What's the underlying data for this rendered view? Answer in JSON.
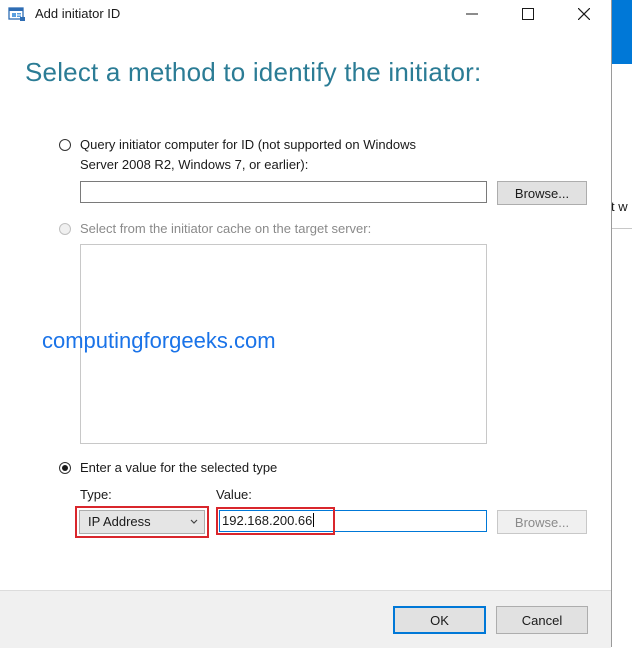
{
  "window": {
    "title": "Add initiator ID",
    "icon": "iscsi-initiator-icon"
  },
  "heading": "Select a method to identify the initiator:",
  "options": {
    "query": {
      "label_line1": "Query initiator computer for ID (not supported on Windows",
      "label_line2": "Server 2008 R2, Windows 7, or earlier):",
      "input_value": "",
      "browse_label": "Browse...",
      "selected": false
    },
    "cache": {
      "label": "Select from the initiator cache on the target server:",
      "selected": false,
      "enabled": false
    },
    "enter_value": {
      "label": "Enter a value for the selected type",
      "selected": true,
      "type_label": "Type:",
      "value_label": "Value:",
      "type_selected": "IP Address",
      "value": "192.168.200.66",
      "browse_label": "Browse...",
      "browse_enabled": false
    }
  },
  "watermark": "computingforgeeks.com",
  "footer": {
    "ok_label": "OK",
    "cancel_label": "Cancel"
  },
  "background_window": {
    "partial_text": "t w"
  },
  "colors": {
    "heading": "#2b7c95",
    "accent": "#0078d7",
    "highlight": "#d9262c",
    "watermark": "#1a73e8"
  }
}
